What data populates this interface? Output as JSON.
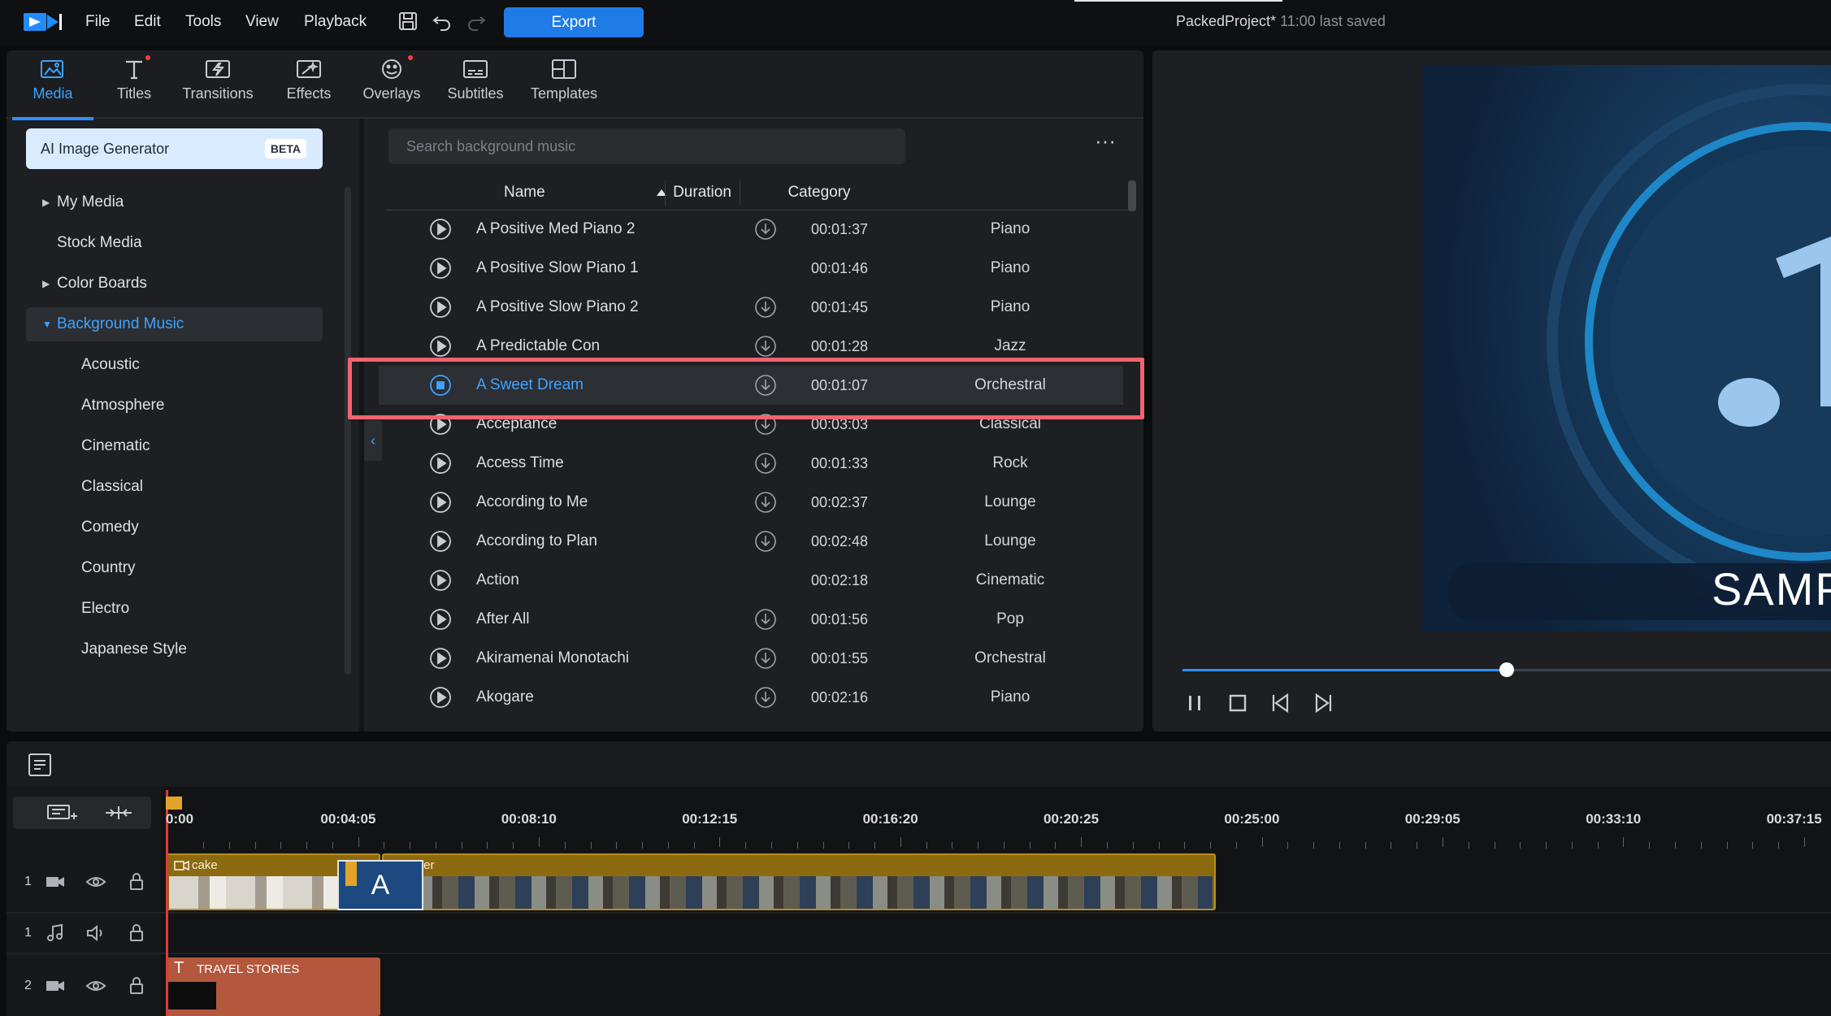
{
  "menubar": {
    "menus": [
      "File",
      "Edit",
      "Tools",
      "View",
      "Playback"
    ],
    "export_label": "Export",
    "project_name": "PackedProject*",
    "last_saved": "11:00 last saved"
  },
  "tabs": [
    {
      "label": "Media",
      "icon": "media-icon",
      "active": true
    },
    {
      "label": "Titles",
      "icon": "titles-icon",
      "new_dot": true
    },
    {
      "label": "Transitions",
      "icon": "transitions-icon"
    },
    {
      "label": "Effects",
      "icon": "effects-icon"
    },
    {
      "label": "Overlays",
      "icon": "overlays-icon",
      "new_dot": true
    },
    {
      "label": "Subtitles",
      "icon": "subtitles-icon"
    },
    {
      "label": "Templates",
      "icon": "templates-icon"
    }
  ],
  "sidebar": {
    "ai_generator": {
      "label": "AI Image Generator",
      "badge": "BETA"
    },
    "items": [
      {
        "label": "My Media",
        "expandable": true
      },
      {
        "label": "Stock Media"
      },
      {
        "label": "Color Boards",
        "expandable": true
      },
      {
        "label": "Background Music",
        "expanded": true,
        "selected": true
      },
      {
        "label": "Acoustic"
      },
      {
        "label": "Atmosphere"
      },
      {
        "label": "Cinematic"
      },
      {
        "label": "Classical"
      },
      {
        "label": "Comedy"
      },
      {
        "label": "Country"
      },
      {
        "label": "Electro"
      },
      {
        "label": "Japanese Style"
      }
    ]
  },
  "search": {
    "placeholder": "Search background music"
  },
  "list": {
    "columns": {
      "name": "Name",
      "duration": "Duration",
      "category": "Category"
    },
    "sort": "name-ascending",
    "rows": [
      {
        "name": "A Positive Med Piano 2",
        "duration": "00:01:37",
        "category": "Piano",
        "download": true
      },
      {
        "name": "A Positive Slow Piano 1",
        "duration": "00:01:46",
        "category": "Piano",
        "download": false
      },
      {
        "name": "A Positive Slow Piano 2",
        "duration": "00:01:45",
        "category": "Piano",
        "download": true
      },
      {
        "name": "A Predictable Con",
        "duration": "00:01:28",
        "category": "Jazz",
        "download": true
      },
      {
        "name": "A Sweet Dream",
        "duration": "00:01:07",
        "category": "Orchestral",
        "download": true,
        "selected": true,
        "playing": true
      },
      {
        "name": "Acceptance",
        "duration": "00:03:03",
        "category": "Classical",
        "download": true
      },
      {
        "name": "Access Time",
        "duration": "00:01:33",
        "category": "Rock",
        "download": true
      },
      {
        "name": "According to Me",
        "duration": "00:02:37",
        "category": "Lounge",
        "download": true
      },
      {
        "name": "According to Plan",
        "duration": "00:02:48",
        "category": "Lounge",
        "download": true
      },
      {
        "name": "Action",
        "duration": "00:02:18",
        "category": "Cinematic",
        "download": false
      },
      {
        "name": "After All",
        "duration": "00:01:56",
        "category": "Pop",
        "download": true
      },
      {
        "name": "Akiramenai Monotachi",
        "duration": "00:01:55",
        "category": "Orchestral",
        "download": true
      },
      {
        "name": "Akogare",
        "duration": "00:02:16",
        "category": "Piano",
        "download": true
      }
    ]
  },
  "preview": {
    "overlay_text": "SAMP",
    "progress": 0.35
  },
  "timeline": {
    "ticks": [
      "0:00",
      "00:04:05",
      "00:08:10",
      "00:12:15",
      "00:16:20",
      "00:20:25",
      "00:25:00",
      "00:29:05",
      "00:33:10",
      "00:37:15"
    ],
    "tracks": [
      {
        "number": "1",
        "type": "video"
      },
      {
        "number": "1",
        "type": "audio"
      },
      {
        "number": "2",
        "type": "video"
      }
    ],
    "clips": {
      "cake": "cake",
      "lover": "lover",
      "title_letter": "A",
      "travel": "TRAVEL STORIES"
    }
  },
  "colors": {
    "accent": "#2e8fff",
    "highlight_box": "#f06470",
    "video_clip": "#8c6a10",
    "title_clip": "#b3583d"
  }
}
